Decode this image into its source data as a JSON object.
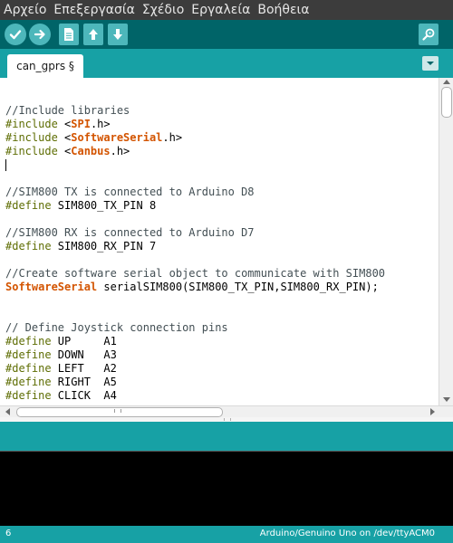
{
  "menubar": {
    "items": [
      {
        "label": "Αρχείο"
      },
      {
        "label": "Επεξεργασία"
      },
      {
        "label": "Σχέδιο"
      },
      {
        "label": "Εργαλεία"
      },
      {
        "label": "Βοήθεια"
      }
    ]
  },
  "toolbar": {
    "buttons": [
      {
        "icon": "checkmark-icon",
        "action": "verify"
      },
      {
        "icon": "arrow-right-icon",
        "action": "upload"
      },
      {
        "icon": "new-file-icon",
        "action": "new"
      },
      {
        "icon": "arrow-up-icon",
        "action": "open"
      },
      {
        "icon": "arrow-down-icon",
        "action": "save"
      },
      {
        "icon": "serial-monitor-icon",
        "action": "serial-monitor"
      }
    ]
  },
  "tabs": [
    {
      "label": "can_gprs §",
      "active": true
    }
  ],
  "editor": {
    "lines": [
      [],
      [
        {
          "t": "//Include libraries",
          "c": "cm"
        }
      ],
      [
        {
          "t": "#include",
          "c": "kw"
        },
        {
          "t": " <",
          "c": "tx"
        },
        {
          "t": "SPI",
          "c": "lib"
        },
        {
          "t": ".h>",
          "c": "tx"
        }
      ],
      [
        {
          "t": "#include",
          "c": "kw"
        },
        {
          "t": " <",
          "c": "tx"
        },
        {
          "t": "SoftwareSerial",
          "c": "lib"
        },
        {
          "t": ".h>",
          "c": "tx"
        }
      ],
      [
        {
          "t": "#include",
          "c": "kw"
        },
        {
          "t": " <",
          "c": "tx"
        },
        {
          "t": "Canbus",
          "c": "lib"
        },
        {
          "t": ".h>",
          "c": "tx"
        }
      ],
      [
        {
          "t": "",
          "c": "cursor"
        }
      ],
      [],
      [
        {
          "t": "//SIM800 TX is connected to Arduino D8",
          "c": "cm"
        }
      ],
      [
        {
          "t": "#define",
          "c": "kw"
        },
        {
          "t": " SIM800_TX_PIN 8",
          "c": "tx"
        }
      ],
      [],
      [
        {
          "t": "//SIM800 RX is connected to Arduino D7",
          "c": "cm"
        }
      ],
      [
        {
          "t": "#define",
          "c": "kw"
        },
        {
          "t": " SIM800_RX_PIN 7",
          "c": "tx"
        }
      ],
      [],
      [
        {
          "t": "//Create software serial object to communicate with SIM800",
          "c": "cm"
        }
      ],
      [
        {
          "t": "SoftwareSerial",
          "c": "lib"
        },
        {
          "t": " serialSIM800(SIM800_TX_PIN,SIM800_RX_PIN);",
          "c": "tx"
        }
      ],
      [],
      [],
      [
        {
          "t": "// Define Joystick connection pins",
          "c": "cm"
        }
      ],
      [
        {
          "t": "#define",
          "c": "kw"
        },
        {
          "t": " UP     A1",
          "c": "tx"
        }
      ],
      [
        {
          "t": "#define",
          "c": "kw"
        },
        {
          "t": " DOWN   A3",
          "c": "tx"
        }
      ],
      [
        {
          "t": "#define",
          "c": "kw"
        },
        {
          "t": " LEFT   A2",
          "c": "tx"
        }
      ],
      [
        {
          "t": "#define",
          "c": "kw"
        },
        {
          "t": " RIGHT  A5",
          "c": "tx"
        }
      ],
      [
        {
          "t": "#define",
          "c": "kw"
        },
        {
          "t": " CLICK  A4",
          "c": "tx"
        }
      ]
    ]
  },
  "statusbar": {
    "line_number": "6",
    "board": "Arduino/Genuino Uno on /dev/ttyACM0"
  },
  "colors": {
    "menubar_bg": "#3c3c3c",
    "toolbar_bg": "#006468",
    "accent_teal": "#17a1a5",
    "button_bg": "#4db7bb",
    "keyword": "#5e6d03",
    "library": "#d35400",
    "comment": "#434f54"
  }
}
